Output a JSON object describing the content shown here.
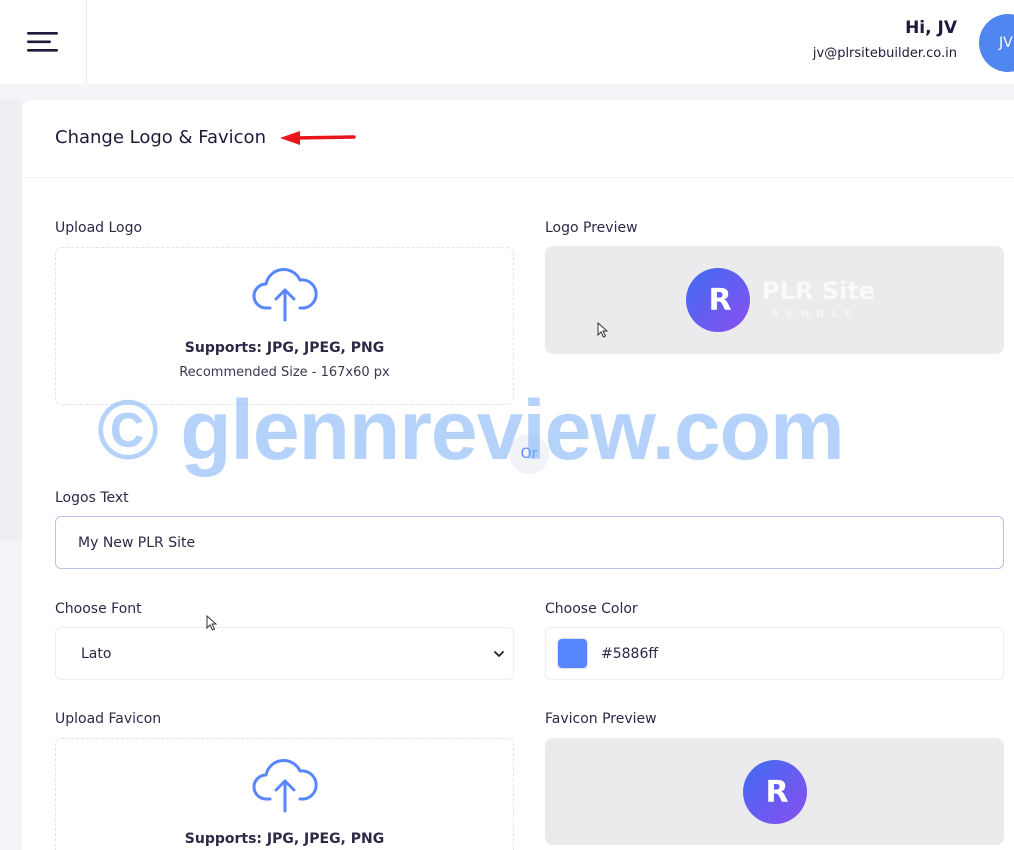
{
  "header": {
    "greeting": "Hi, JV",
    "email": "jv@plrsitebuilder.co.in",
    "avatar_initials": "JV"
  },
  "card": {
    "title": "Change Logo & Favicon"
  },
  "upload_logo": {
    "label": "Upload Logo",
    "supports": "Supports: JPG, JPEG, PNG",
    "recommended": "Recommended Size - 167x60 px"
  },
  "logo_preview": {
    "label": "Logo Preview",
    "brand_mark": "R",
    "brand_name": "PLR Site",
    "brand_sub": "BUNDLE"
  },
  "divider": {
    "or": "Or"
  },
  "logos_text": {
    "label": "Logos Text",
    "value": "My New PLR Site"
  },
  "choose_font": {
    "label": "Choose Font",
    "selected": "Lato"
  },
  "choose_color": {
    "label": "Choose Color",
    "value": "#5886ff",
    "swatch": "#5886ff"
  },
  "upload_favicon": {
    "label": "Upload Favicon",
    "supports": "Supports: JPG, JPEG, PNG"
  },
  "favicon_preview": {
    "label": "Favicon Preview",
    "brand_mark": "R"
  },
  "watermark": "© glennreview.com",
  "colors": {
    "accent": "#5886ff",
    "annotation_arrow": "#e8161b"
  },
  "icons": [
    "menu-icon",
    "upload-cloud-icon",
    "chevron-down-icon"
  ]
}
